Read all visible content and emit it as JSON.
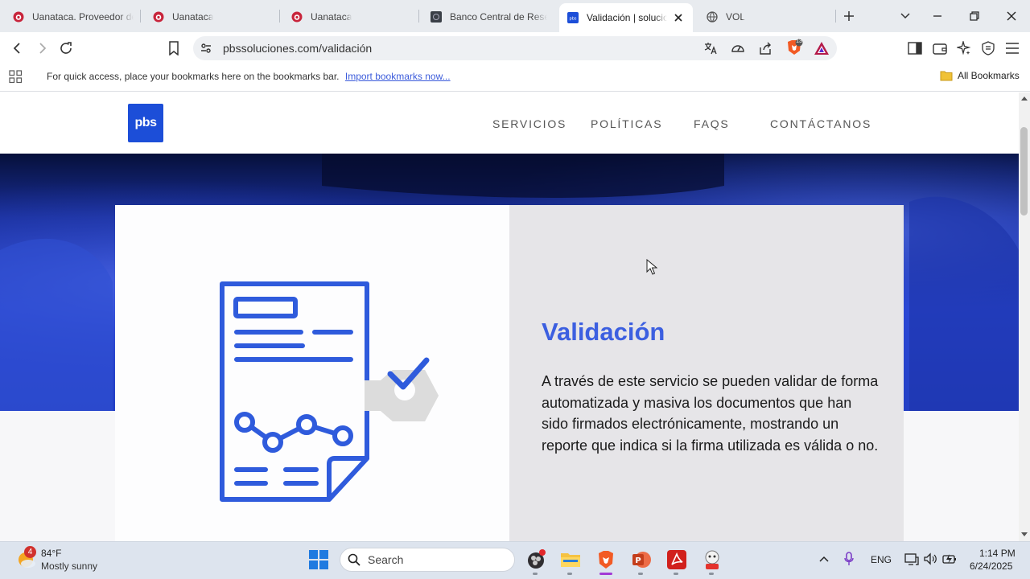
{
  "browser": {
    "tabs": [
      {
        "title": "Uanataca. Proveedor de",
        "active": false
      },
      {
        "title": "Uanataca",
        "active": false
      },
      {
        "title": "Uanataca",
        "active": false
      },
      {
        "title": "Banco Central de Rese",
        "active": false
      },
      {
        "title": "Validación | solucio",
        "active": true
      },
      {
        "title": "VOL",
        "active": false
      }
    ],
    "url": "pbssoluciones.com/validación",
    "bookmarks_bar": {
      "prompt": "For quick access, place your bookmarks here on the bookmarks bar.",
      "import_link": "Import bookmarks now...",
      "all_bookmarks": "All Bookmarks"
    },
    "shield_count": "13"
  },
  "site": {
    "logo": "pbs",
    "nav": [
      "SERVICIOS",
      "POLÍTICAS",
      "FAQS",
      "CONTÁCTANOS"
    ],
    "section_title": "Validación",
    "section_text": "A través de este servicio se pueden validar de forma automatizada y masiva los documentos que han sido firmados electrónicamente, mostrando un reporte que indica si la firma utilizada es válida o no."
  },
  "taskbar": {
    "weather_badge": "4",
    "temp": "84°F",
    "weather": "Mostly sunny",
    "search_placeholder": "Search",
    "lang": "ENG",
    "time": "1:14 PM",
    "date": "6/24/2025"
  },
  "colors": {
    "accent": "#3c5fe0",
    "brand": "#1c4ed8",
    "hero": "#2a47d6"
  }
}
